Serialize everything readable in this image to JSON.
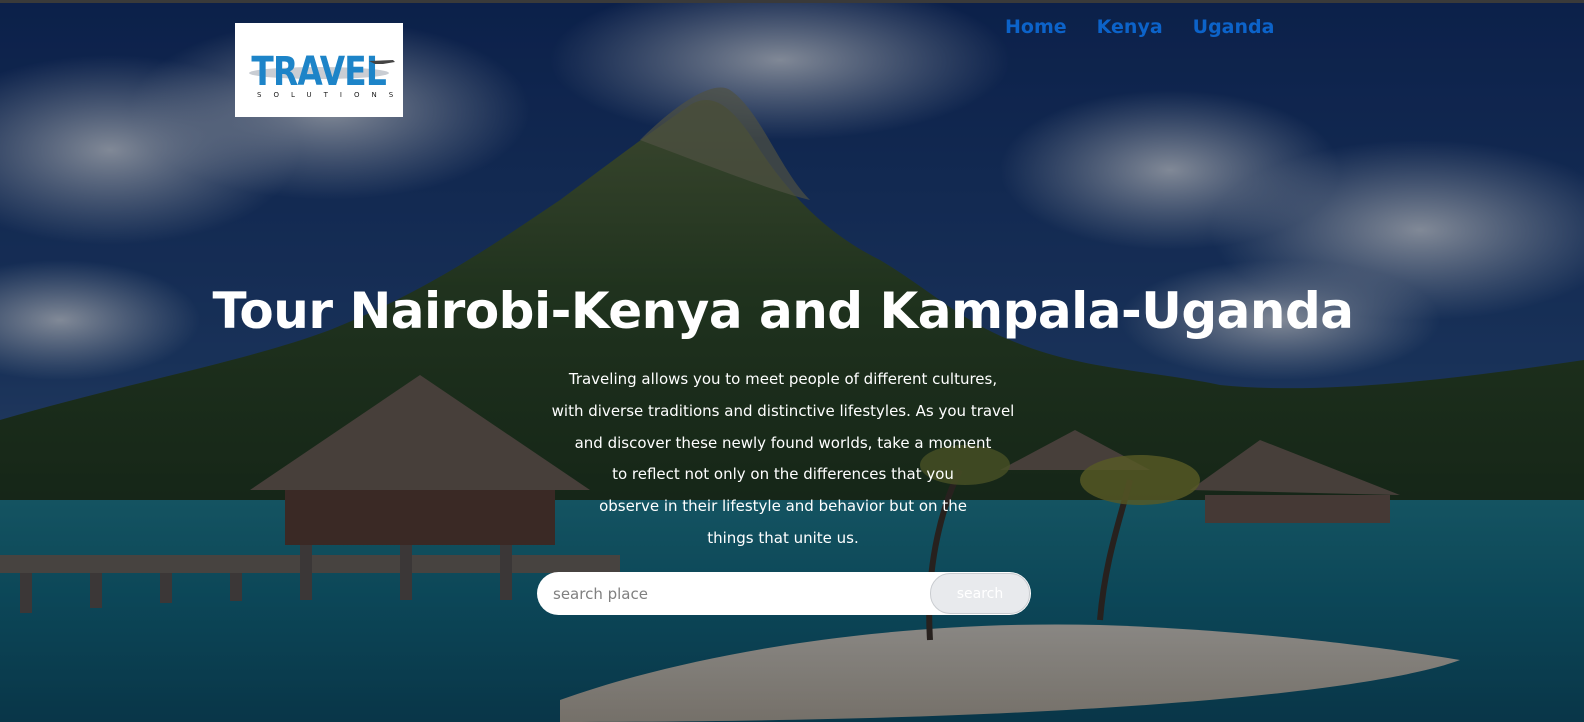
{
  "logo": {
    "brand": "TRAVEL",
    "tagline": "SOLUTIONS"
  },
  "nav": {
    "items": [
      {
        "label": "Home"
      },
      {
        "label": "Kenya"
      },
      {
        "label": "Uganda"
      }
    ],
    "link_color": "#0c63c9"
  },
  "hero": {
    "title": "Tour Nairobi-Kenya and Kampala-Uganda",
    "paragraph_lines": [
      "Traveling allows you to meet people of different cultures,",
      "with diverse traditions and distinctive lifestyles. As you travel",
      "and discover these newly found worlds, take a moment",
      "to reflect not only on the differences that you",
      "observe in their lifestyle and behavior but on the",
      "things that unite us."
    ]
  },
  "search": {
    "placeholder": "search place",
    "value": "",
    "button_label": "search"
  }
}
